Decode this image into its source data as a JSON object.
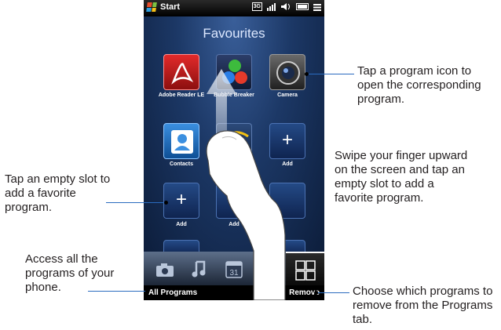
{
  "statusbar": {
    "start": "Start",
    "network": "3G"
  },
  "screen": {
    "title": "Favourites"
  },
  "tiles": [
    {
      "label": "Adobe Reader LE"
    },
    {
      "label": "Bubble Breaker"
    },
    {
      "label": "Camera"
    },
    {
      "label": "Contacts"
    },
    {
      "label": ""
    },
    {
      "label": "Add",
      "glyph": "+"
    },
    {
      "label": "Add",
      "glyph": "+"
    },
    {
      "label": "Add"
    }
  ],
  "tabs": [
    "camera-tab",
    "music-tab",
    "calendar-tab",
    "settings-tab",
    "programs-tab"
  ],
  "calendar_day": "31",
  "softkeys": {
    "left": "All Programs",
    "right": "Remove"
  },
  "callouts": {
    "tap_icon": "Tap a program icon to open the corresponding program.",
    "swipe": "Swipe your finger upward on the screen and tap an empty slot to add a favorite program.",
    "empty_slot": "Tap an empty slot to add a favorite program.",
    "access_all": "Access all the programs of your phone.",
    "remove": "Choose which programs to remove from the Programs tab."
  }
}
